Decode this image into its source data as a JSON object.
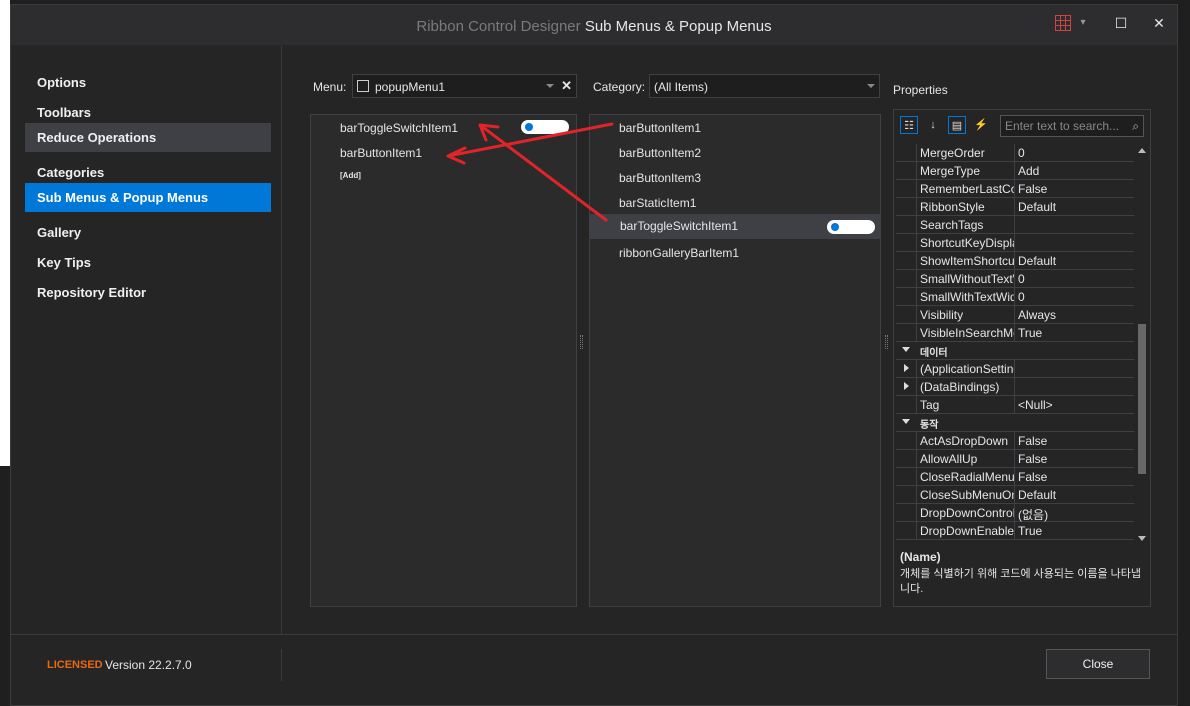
{
  "window": {
    "app_title": "Ribbon Control Designer",
    "page_title": "Sub Menus & Popup Menus",
    "maximize_glyph": "☐",
    "close_glyph": "✕"
  },
  "sidebar": {
    "items": [
      {
        "label": "Options"
      },
      {
        "label": "Toolbars"
      },
      {
        "label": "Reduce Operations"
      },
      {
        "label": "Categories"
      },
      {
        "label": "Sub Menus & Popup Menus"
      },
      {
        "label": "Gallery"
      },
      {
        "label": "Key Tips"
      },
      {
        "label": "Repository Editor"
      }
    ]
  },
  "menu": {
    "label": "Menu:",
    "value": "popupMenu1",
    "clear_glyph": "✕",
    "items": [
      "barToggleSwitchItem1",
      "barButtonItem1"
    ],
    "add_label": "[Add]"
  },
  "category": {
    "label": "Category:",
    "value": "(All Items)",
    "items": [
      "barButtonItem1",
      "barButtonItem2",
      "barButtonItem3",
      "barStaticItem1",
      "barToggleSwitchItem1",
      "ribbonGalleryBarItem1"
    ]
  },
  "properties": {
    "title": "Properties",
    "search_placeholder": "Enter text to search...",
    "rows": [
      {
        "name": "MergeOrder",
        "value": "0"
      },
      {
        "name": "MergeType",
        "value": "Add"
      },
      {
        "name": "RememberLastCommand",
        "value": "False"
      },
      {
        "name": "RibbonStyle",
        "value": "Default"
      },
      {
        "name": "SearchTags",
        "value": ""
      },
      {
        "name": "ShortcutKeyDisplayString",
        "value": ""
      },
      {
        "name": "ShowItemShortcut",
        "value": "Default"
      },
      {
        "name": "SmallWithoutTextWidth",
        "value": "0"
      },
      {
        "name": "SmallWithTextWidth",
        "value": "0"
      },
      {
        "name": "Visibility",
        "value": "Always"
      },
      {
        "name": "VisibleInSearchMenu",
        "value": "True"
      },
      {
        "name": "데이터",
        "value": "",
        "category": true
      },
      {
        "name": "(ApplicationSettings)",
        "value": "",
        "expandable": true
      },
      {
        "name": "(DataBindings)",
        "value": "",
        "expandable": true
      },
      {
        "name": "Tag",
        "value": "<Null>"
      },
      {
        "name": "동작",
        "value": "",
        "category": true
      },
      {
        "name": "ActAsDropDown",
        "value": "False"
      },
      {
        "name": "AllowAllUp",
        "value": "False"
      },
      {
        "name": "CloseRadialMenuOnItemClick",
        "value": "False"
      },
      {
        "name": "CloseSubMenuOnClick",
        "value": "Default"
      },
      {
        "name": "DropDownControl",
        "value": "(없음)"
      },
      {
        "name": "DropDownEnabled",
        "value": "True"
      }
    ],
    "desc_title": "(Name)",
    "desc_text": "개체를 식별하기 위해 코드에 사용되는 이름을 나타냅니다."
  },
  "footer": {
    "licensed": "LICENSED",
    "version": "Version 22.2.7.0",
    "close_label": "Close"
  },
  "colors": {
    "accent": "#0078d7",
    "licensed": "#e86a10",
    "annotation": "#e0242a"
  }
}
